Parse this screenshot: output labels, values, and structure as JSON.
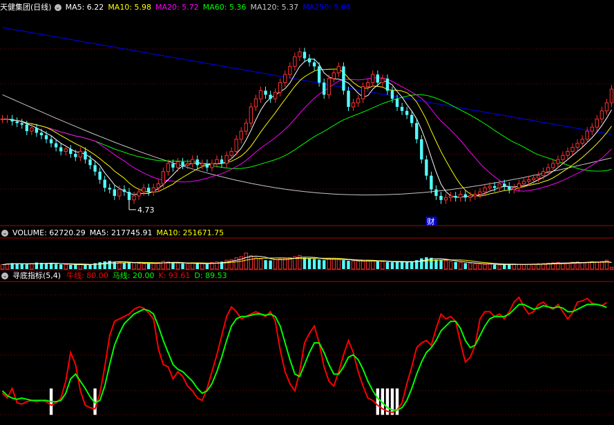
{
  "header": {
    "title": "天健集团(日线)",
    "ma_items": [
      {
        "label": "MA5: 6.22",
        "color": "#ffffff"
      },
      {
        "label": "MA10: 5.98",
        "color": "#ffff00"
      },
      {
        "label": "MA20: 5.72",
        "color": "#ff00ff"
      },
      {
        "label": "MA60: 5.36",
        "color": "#00ff00"
      },
      {
        "label": "MA120: 5.37",
        "color": "#c8c8c8"
      },
      {
        "label": "MA250: 5.66",
        "color": "#0000ff"
      }
    ]
  },
  "volume_header": {
    "items": [
      {
        "label": "VOLUME: 62720.29",
        "color": "#ffffff"
      },
      {
        "label": "MA5: 217745.91",
        "color": "#ffffff"
      },
      {
        "label": "MA10: 251671.75",
        "color": "#ffff00"
      }
    ]
  },
  "indicator_header": {
    "title": "寻底指标(5,4)",
    "items": [
      {
        "label": "牛线: 80.00",
        "color": "#ff0000"
      },
      {
        "label": "马线: 20.00",
        "color": "#00ff00"
      },
      {
        "label": "K: 93.61",
        "color": "#ff0000"
      },
      {
        "label": "D: 89.53",
        "color": "#00ff00"
      }
    ]
  },
  "annotations": {
    "low_label": "4.73",
    "marker": "财"
  },
  "colors": {
    "up": "#ff3232",
    "down": "#54ffff",
    "grid": "#8b0000",
    "k_line": "#ff0000",
    "d_line": "#00ff00"
  },
  "chart_data": [
    {
      "type": "line",
      "name": "price",
      "x_count": 126,
      "ylim": [
        4.55,
        7.15
      ],
      "ma5_end": 6.22,
      "ma10_end": 5.98,
      "ma20_end": 5.72,
      "ma60_end": 5.36,
      "ma120_end": 5.37,
      "ma250_end": 5.66,
      "close": [
        5.85,
        5.85,
        5.82,
        5.8,
        5.78,
        5.7,
        5.74,
        5.68,
        5.65,
        5.6,
        5.55,
        5.5,
        5.45,
        5.48,
        5.42,
        5.38,
        5.45,
        5.35,
        5.28,
        5.2,
        5.1,
        5.0,
        4.98,
        4.9,
        4.98,
        4.95,
        4.85,
        4.9,
        4.95,
        5.0,
        4.95,
        5.0,
        5.05,
        5.2,
        5.3,
        5.25,
        5.32,
        5.28,
        5.3,
        5.35,
        5.28,
        5.3,
        5.25,
        5.3,
        5.35,
        5.3,
        5.4,
        5.45,
        5.6,
        5.7,
        5.8,
        6.0,
        6.1,
        6.2,
        6.15,
        6.1,
        6.18,
        6.3,
        6.4,
        6.5,
        6.62,
        6.68,
        6.6,
        6.55,
        6.5,
        6.3,
        6.15,
        6.35,
        6.42,
        6.5,
        6.2,
        6.0,
        6.05,
        6.1,
        6.25,
        6.3,
        6.4,
        6.3,
        6.35,
        6.2,
        6.1,
        6.0,
        5.95,
        5.9,
        5.8,
        5.6,
        5.35,
        5.15,
        4.98,
        4.9,
        4.85,
        4.88,
        4.9,
        4.88,
        4.92,
        4.88,
        4.9,
        4.92,
        4.95,
        5.0,
        5.02,
        5.0,
        5.05,
        5.02,
        4.98,
        5.0,
        5.05,
        5.08,
        5.1,
        5.12,
        5.15,
        5.2,
        5.25,
        5.3,
        5.35,
        5.4,
        5.45,
        5.5,
        5.55,
        5.6,
        5.7,
        5.75,
        5.85,
        5.95,
        6.05,
        6.22
      ]
    },
    {
      "type": "bar",
      "name": "volume",
      "x_count": 126,
      "ylim": [
        0,
        1000000
      ],
      "values": [
        150000,
        180000,
        200000,
        190000,
        170000,
        160000,
        180000,
        220000,
        210000,
        200000,
        190000,
        170000,
        160000,
        150000,
        140000,
        150000,
        160000,
        150000,
        140000,
        200000,
        230000,
        260000,
        280000,
        240000,
        230000,
        220000,
        210000,
        200000,
        190000,
        180000,
        190000,
        200000,
        220000,
        260000,
        240000,
        210000,
        200000,
        190000,
        180000,
        200000,
        190000,
        180000,
        170000,
        220000,
        240000,
        250000,
        300000,
        320000,
        380000,
        420000,
        540000,
        450000,
        380000,
        340000,
        300000,
        290000,
        320000,
        340000,
        360000,
        380000,
        420000,
        460000,
        380000,
        360000,
        340000,
        320000,
        300000,
        360000,
        340000,
        320000,
        300000,
        280000,
        270000,
        260000,
        270000,
        290000,
        280000,
        260000,
        250000,
        240000,
        230000,
        240000,
        250000,
        230000,
        260000,
        300000,
        360000,
        400000,
        380000,
        320000,
        300000,
        280000,
        260000,
        240000,
        220000,
        200000,
        190000,
        180000,
        170000,
        160000,
        170000,
        150000,
        140000,
        150000,
        160000,
        170000,
        160000,
        150000,
        160000,
        170000,
        180000,
        190000,
        200000,
        210000,
        220000,
        200000,
        210000,
        230000,
        240000,
        220000,
        230000,
        250000,
        240000,
        260000,
        300000,
        62720
      ]
    },
    {
      "type": "line",
      "name": "indicator",
      "x_count": 126,
      "ylim": [
        -5,
        110
      ],
      "series": [
        {
          "name": "K",
          "values": [
            18,
            14,
            22,
            10,
            9,
            11,
            12,
            11,
            12,
            11,
            8,
            10,
            14,
            28,
            52,
            42,
            20,
            8,
            6,
            5,
            18,
            40,
            66,
            78,
            80,
            82,
            84,
            88,
            90,
            89,
            85,
            80,
            55,
            42,
            40,
            30,
            36,
            32,
            24,
            20,
            14,
            12,
            22,
            36,
            50,
            66,
            82,
            90,
            86,
            80,
            82,
            84,
            86,
            84,
            82,
            86,
            78,
            54,
            36,
            26,
            20,
            36,
            60,
            68,
            74,
            60,
            40,
            28,
            24,
            36,
            50,
            62,
            52,
            36,
            24,
            14,
            12,
            8,
            5,
            3,
            2,
            4,
            10,
            26,
            40,
            56,
            60,
            62,
            58,
            72,
            84,
            80,
            82,
            78,
            60,
            44,
            48,
            58,
            80,
            86,
            86,
            82,
            84,
            80,
            86,
            94,
            98,
            90,
            84,
            86,
            92,
            94,
            90,
            88,
            92,
            86,
            80,
            85,
            94,
            95,
            97,
            93,
            92,
            91,
            93.61
          ]
        },
        {
          "name": "D",
          "values": [
            20,
            16,
            14,
            13,
            14,
            13,
            12,
            12,
            12,
            12,
            11,
            11,
            12,
            18,
            30,
            34,
            28,
            22,
            15,
            10,
            12,
            24,
            42,
            58,
            68,
            76,
            80,
            84,
            86,
            88,
            87,
            84,
            74,
            62,
            52,
            42,
            38,
            36,
            32,
            28,
            22,
            18,
            20,
            26,
            36,
            48,
            62,
            74,
            80,
            82,
            82,
            83,
            84,
            84,
            83,
            84,
            82,
            74,
            60,
            46,
            34,
            32,
            42,
            52,
            60,
            60,
            52,
            42,
            34,
            34,
            40,
            48,
            50,
            46,
            38,
            28,
            20,
            14,
            10,
            6,
            4,
            4,
            6,
            12,
            22,
            34,
            44,
            52,
            56,
            62,
            70,
            74,
            78,
            78,
            72,
            62,
            56,
            58,
            66,
            74,
            80,
            82,
            82,
            82,
            84,
            88,
            92,
            92,
            90,
            88,
            89,
            91,
            90,
            89,
            90,
            89,
            86,
            86,
            88,
            90,
            92,
            92,
            92,
            91,
            89.53
          ]
        }
      ]
    }
  ]
}
